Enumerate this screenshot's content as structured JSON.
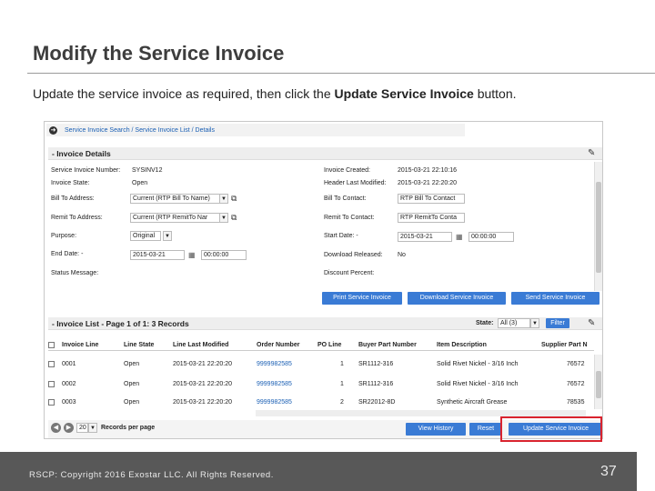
{
  "slide": {
    "title": "Modify the Service Invoice",
    "instruction_pre": "Update the service invoice as required, then click the ",
    "instruction_bold": "Update Service Invoice",
    "instruction_post": " button.",
    "footer": "RSCP: Copyright 2016 Exostar LLC. All Rights Reserved.",
    "page_number": "37",
    "highlight_color": "#d9232e"
  },
  "app": {
    "breadcrumb": "Service Invoice Search / Service Invoice List / Details",
    "invoice_details": {
      "title": "- Invoice Details",
      "fields_left": [
        {
          "label": "Service Invoice Number:",
          "value": "SYSINV12"
        },
        {
          "label": "Invoice State:",
          "value": "Open"
        },
        {
          "label": "Bill To Address:",
          "value": "Current (RTP Bill To Name)"
        },
        {
          "label": "Remit To Address:",
          "value": "Current (RTP RemitTo Nar"
        },
        {
          "label": "Purpose:",
          "value": "Original"
        },
        {
          "label": "End Date: -",
          "value": "2015-03-21",
          "time": "00:00:00"
        },
        {
          "label": "Status Message:",
          "value": ""
        }
      ],
      "fields_right": [
        {
          "label": "Invoice Created:",
          "value": "2015-03-21 22:10:16"
        },
        {
          "label": "Header Last Modified:",
          "value": "2015-03-21 22:20:20"
        },
        {
          "label": "Bill To Contact:",
          "value": "RTP Bill To Contact"
        },
        {
          "label": "Remit To Contact:",
          "value": "RTP RemitTo Conta"
        },
        {
          "label": "Start Date: -",
          "value": "2015-03-21",
          "time": "00:00:00"
        },
        {
          "label": "Download Released:",
          "value": "No"
        },
        {
          "label": "Discount Percent:",
          "value": ""
        }
      ],
      "buttons": {
        "print": "Print Service Invoice",
        "download": "Download Service Invoice",
        "send": "Send Service Invoice"
      }
    },
    "invoice_list": {
      "title": "- Invoice List - Page 1 of 1: 3 Records",
      "state_label": "State:",
      "state_value": "All (3)",
      "filter_button": "Filter",
      "columns": [
        "Invoice Line",
        "Line State",
        "Line Last Modified",
        "Order Number",
        "PO Line",
        "Buyer Part Number",
        "Item Description",
        "Supplier Part N"
      ],
      "rows": [
        [
          "0001",
          "Open",
          "2015-03-21 22:20:20",
          "9999982585",
          "1",
          "SR1112-316",
          "Solid Rivet Nickel - 3/16 Inch",
          "76572"
        ],
        [
          "0002",
          "Open",
          "2015-03-21 22:20:20",
          "9999982585",
          "1",
          "SR1112-316",
          "Solid Rivet Nickel - 3/16 Inch",
          "76572"
        ],
        [
          "0003",
          "Open",
          "2015-03-21 22:20:20",
          "9999982585",
          "2",
          "SR22012-8D",
          "Synthetic Aircraft Grease",
          "78535"
        ]
      ],
      "per_page_value": "20",
      "per_page_label": "Records per page",
      "buttons": {
        "history": "View History",
        "reset": "Reset",
        "update": "Update Service Invoice"
      }
    }
  }
}
